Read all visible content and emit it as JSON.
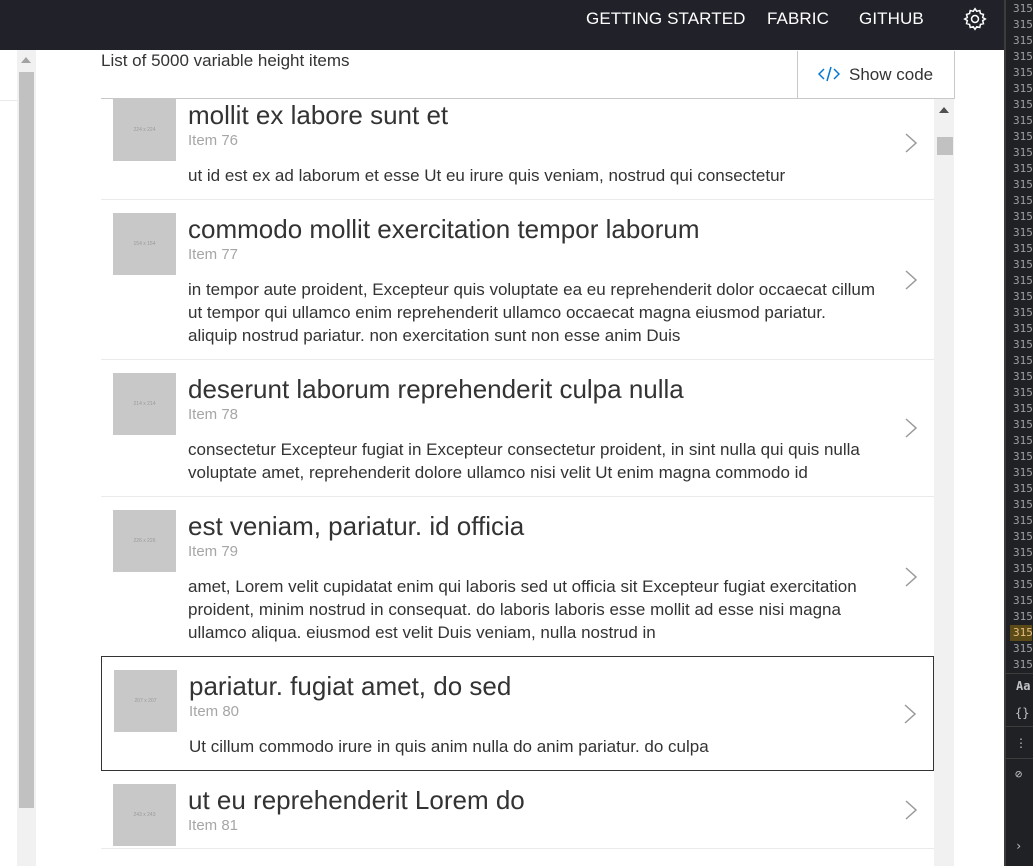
{
  "topnav": {
    "items": [
      "GETTING STARTED",
      "FABRIC",
      "GITHUB"
    ],
    "settings_icon": "gear-icon"
  },
  "header": {
    "list_title": "List of 5000 variable height items",
    "show_code_label": "Show code",
    "show_code_icon": "code-icon"
  },
  "items": [
    {
      "name": "mollit ex labore sunt et",
      "index": "Item 76",
      "thumb": "224 x 224",
      "desc": "ut id est ex ad laborum et esse Ut eu irure quis veniam, nostrud qui consectetur"
    },
    {
      "name": "commodo mollit exercitation tempor laborum",
      "index": "Item 77",
      "thumb": "154 x 154",
      "desc": "in tempor aute proident, Excepteur quis voluptate ea eu reprehenderit dolor occaecat cillum ut tempor qui ullamco enim reprehenderit ullamco occaecat magna eiusmod pariatur. aliquip nostrud pariatur. non exercitation sunt non esse anim Duis"
    },
    {
      "name": "deserunt laborum reprehenderit culpa nulla",
      "index": "Item 78",
      "thumb": "214 x 214",
      "desc": "consectetur Excepteur fugiat in Excepteur consectetur proident, in sint nulla qui quis nulla voluptate amet, reprehenderit dolore ullamco nisi velit Ut enim magna commodo id"
    },
    {
      "name": "est veniam, pariatur. id officia",
      "index": "Item 79",
      "thumb": "226 x 226",
      "desc": "amet, Lorem velit cupidatat enim qui laboris sed ut officia sit Excepteur fugiat exercitation proident, minim nostrud in consequat. do laboris laboris esse mollit ad esse nisi magna ullamco aliqua. eiusmod est velit Duis veniam, nulla nostrud in"
    },
    {
      "name": "pariatur. fugiat amet, do sed",
      "index": "Item 80",
      "thumb": "207 x 207",
      "desc": "Ut cillum commodo irure in quis anim nulla do anim pariatur. do culpa"
    },
    {
      "name": "ut eu reprehenderit Lorem do",
      "index": "Item 81",
      "thumb": "243 x 243",
      "desc": ""
    }
  ],
  "selected_index": 4,
  "devtools": {
    "line_numbers": [
      "315",
      "315",
      "315",
      "315",
      "315",
      "315",
      "315",
      "315",
      "315",
      "315",
      "315",
      "315",
      "315",
      "315",
      "315",
      "315",
      "315",
      "315",
      "315",
      "315",
      "315",
      "315",
      "315",
      "315",
      "315",
      "315",
      "315",
      "315",
      "315",
      "315",
      "315",
      "315",
      "315",
      "315",
      "315",
      "315",
      "315",
      "315",
      "315",
      "315",
      "315",
      "315"
    ],
    "highlighted_line": 39,
    "icons": [
      "Aa",
      "{}",
      "⋮",
      "⊘",
      "›"
    ]
  }
}
